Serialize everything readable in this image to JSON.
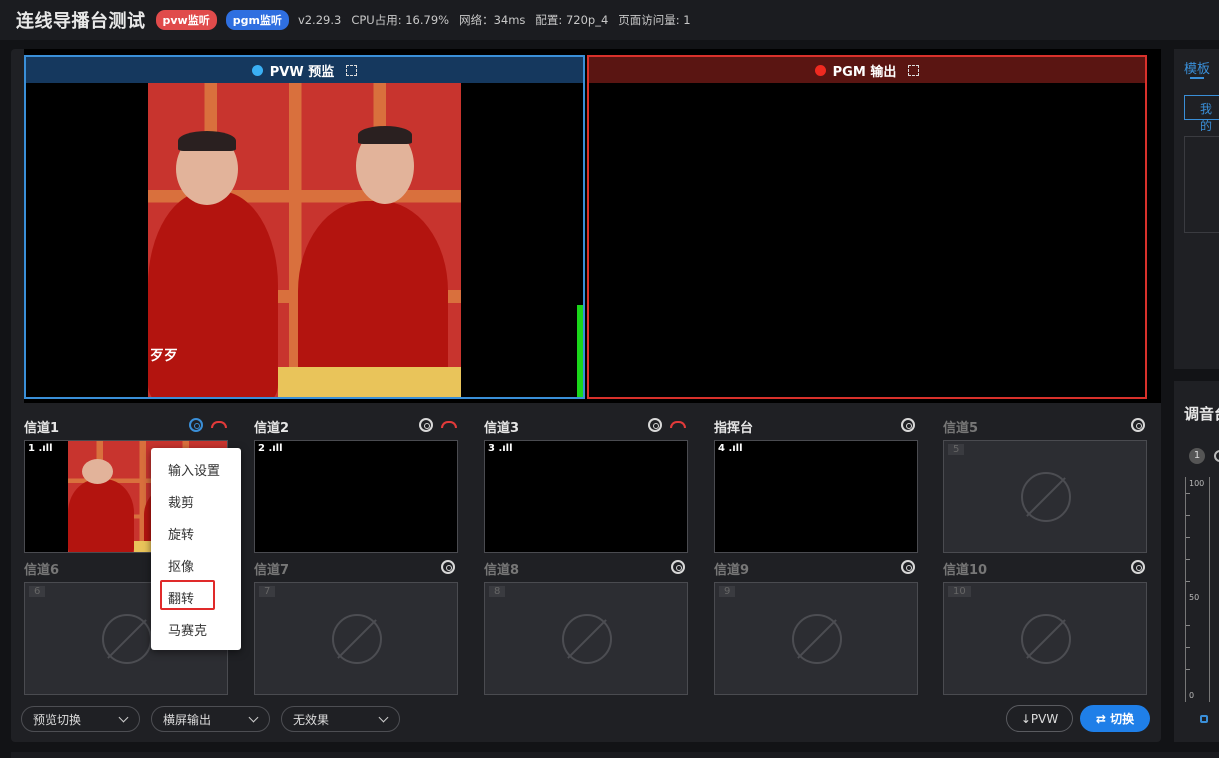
{
  "header": {
    "title": "连线导播台测试",
    "pvw_badge": "pvw监听",
    "pgm_badge": "pgm监听",
    "version": "v2.29.3",
    "cpu": "CPU占用: 16.79%",
    "network": "网络：34ms",
    "config": "配置: 720p_4",
    "visits": "页面访问量: 1"
  },
  "monitors": {
    "pvw_label": "PVW 预监",
    "pgm_label": "PGM 输出"
  },
  "scene_caption": "歹歹",
  "channels": [
    {
      "label": "信道1",
      "num": "1",
      "signal": "1 .ıll",
      "active": true
    },
    {
      "label": "信道2",
      "num": "2",
      "signal": "2 .ıll",
      "active": false
    },
    {
      "label": "信道3",
      "num": "3",
      "signal": "3 .ıll",
      "active": false
    },
    {
      "label": "指挥台",
      "num": "4",
      "signal": "4 .ıll",
      "active": false
    },
    {
      "label": "信道5",
      "num": "5"
    },
    {
      "label": "信道6",
      "num": "6"
    },
    {
      "label": "信道7",
      "num": "7"
    },
    {
      "label": "信道8",
      "num": "8"
    },
    {
      "label": "信道9",
      "num": "9"
    },
    {
      "label": "信道10",
      "num": "10"
    }
  ],
  "context_menu": {
    "items": [
      "输入设置",
      "裁剪",
      "旋转",
      "抠像",
      "翻转",
      "马赛克"
    ],
    "highlighted": "翻转"
  },
  "bottom": {
    "dropdown1": "预览切换",
    "dropdown2": "横屏输出",
    "dropdown3": "无效果",
    "pvw_button": "↓PVW",
    "cut_button": "⇄ 切换"
  },
  "right_panel": {
    "tab_template": "模板",
    "my_button": "我的",
    "mixer_title": "调音台",
    "mixer_channel": "1",
    "scale_top": "100",
    "scale_mid": "50",
    "scale_bottom": "0"
  },
  "colors": {
    "pvw_border": "#3a8fd8",
    "pgm_border": "#d9312b",
    "accent": "#1f7fe8",
    "highlight": "#e02a2a"
  }
}
